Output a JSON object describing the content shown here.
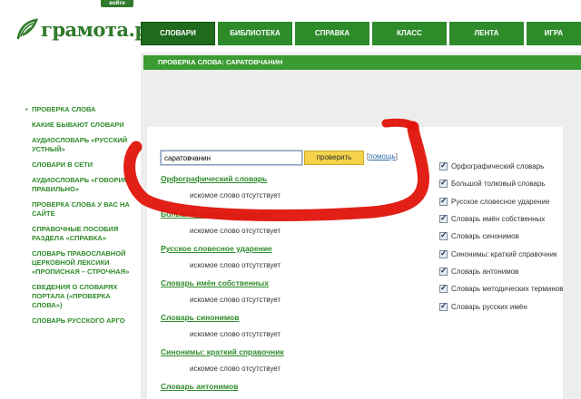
{
  "header": {
    "login_label": "войти",
    "logo_text": "грамота.ру"
  },
  "nav": {
    "tabs": [
      {
        "label": "СЛОВАРИ"
      },
      {
        "label": "БИБЛИОТЕКА"
      },
      {
        "label": "СПРАВКА"
      },
      {
        "label": "КЛАСС"
      },
      {
        "label": "ЛЕНТА"
      },
      {
        "label": "ИГРА"
      }
    ]
  },
  "page_title": "ПРОВЕРКА СЛОВА: САРАТОВЧАНИН",
  "sidebar": {
    "items": [
      {
        "label": "ПРОВЕРКА СЛОВА"
      },
      {
        "label": "КАКИЕ БЫВАЮТ СЛОВАРИ"
      },
      {
        "label": "АУДИОСЛОВАРЬ «РУССКИЙ УСТНЫЙ»"
      },
      {
        "label": "СЛОВАРИ В СЕТИ"
      },
      {
        "label": "АУДИОСЛОВАРЬ «ГОВОРИМ ПРАВИЛЬНО»"
      },
      {
        "label": "ПРОВЕРКА СЛОВА У ВАС НА САЙТЕ"
      },
      {
        "label": "СПРАВОЧНЫЕ ПОСОБИЯ РАЗДЕЛА «СПРАВКА»"
      },
      {
        "label": "СЛОВАРЬ ПРАВОСЛАВНОЙ ЦЕРКОВНОЙ ЛЕКСИКИ «ПРОПИСНАЯ – СТРОЧНАЯ»"
      },
      {
        "label": "СВЕДЕНИЯ О СЛОВАРЯХ ПОРТАЛА («ПРОВЕРКА СЛОВА»)"
      },
      {
        "label": "СЛОВАРЬ РУССКОГО АРГО"
      }
    ]
  },
  "search": {
    "value": "саратовчанин",
    "button_label": "проверить",
    "help_open": "[",
    "help_label": "помощь",
    "help_close": "]"
  },
  "results": [
    {
      "title": "Орфографический словарь",
      "message": "искомое слово отсутствует"
    },
    {
      "title": "Большой толковый словарь",
      "message": "искомое слово отсутствует"
    },
    {
      "title": "Русское словесное ударение",
      "message": "искомое слово отсутствует"
    },
    {
      "title": "Словарь имён собственных",
      "message": "искомое слово отсутствует"
    },
    {
      "title": "Словарь синонимов",
      "message": "искомое слово отсутствует"
    },
    {
      "title": "Синонимы: краткий справочник",
      "message": "искомое слово отсутствует"
    },
    {
      "title": "Словарь антонимов",
      "message": ""
    }
  ],
  "dictionaries": [
    {
      "label": "Орфографический словарь",
      "checked": true
    },
    {
      "label": "Большой толковый словарь",
      "checked": true
    },
    {
      "label": "Русское словесное ударение",
      "checked": true
    },
    {
      "label": "Словарь имён собственных",
      "checked": true
    },
    {
      "label": "Словарь синонимов",
      "checked": true
    },
    {
      "label": "Синонимы: краткий справочник",
      "checked": true
    },
    {
      "label": "Словарь антонимов",
      "checked": true
    },
    {
      "label": "Словарь методических терминов",
      "checked": true
    },
    {
      "label": "Словарь русских имён",
      "checked": true
    }
  ],
  "colors": {
    "brand_green": "#2e8b2a",
    "annotation_red": "#e0140c"
  }
}
